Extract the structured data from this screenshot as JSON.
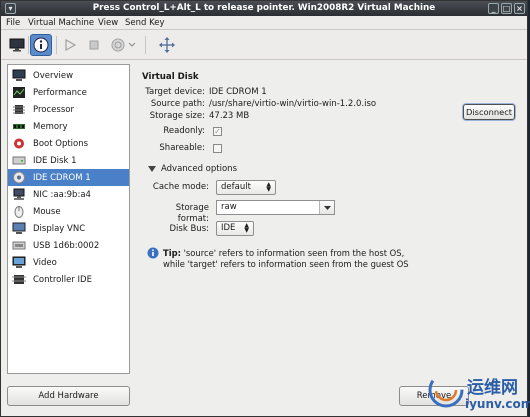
{
  "window": {
    "title": "Press Control_L+Alt_L to release pointer. Win2008R2 Virtual Machine"
  },
  "menubar": {
    "items": [
      "File",
      "Virtual Machine",
      "View",
      "Send Key"
    ]
  },
  "toolbar": {
    "buttons": [
      "screen-icon",
      "info-icon",
      "play-icon",
      "pause-icon",
      "power-icon",
      "dropdown-arrow-icon",
      "fullscreen-icon"
    ],
    "active": "info-icon"
  },
  "sidebar": {
    "items": [
      {
        "label": "Overview",
        "icon": "overview-icon"
      },
      {
        "label": "Performance",
        "icon": "performance-icon"
      },
      {
        "label": "Processor",
        "icon": "processor-icon"
      },
      {
        "label": "Memory",
        "icon": "memory-icon"
      },
      {
        "label": "Boot Options",
        "icon": "boot-icon"
      },
      {
        "label": "IDE Disk 1",
        "icon": "disk-icon"
      },
      {
        "label": "IDE CDROM 1",
        "icon": "cdrom-icon"
      },
      {
        "label": "NIC :aa:9b:a4",
        "icon": "nic-icon"
      },
      {
        "label": "Mouse",
        "icon": "mouse-icon"
      },
      {
        "label": "Display VNC",
        "icon": "display-icon"
      },
      {
        "label": "USB 1d6b:0002",
        "icon": "usb-icon"
      },
      {
        "label": "Video",
        "icon": "video-icon"
      },
      {
        "label": "Controller IDE",
        "icon": "controller-icon"
      }
    ],
    "selected_index": 6,
    "add_hardware_label": "Add Hardware"
  },
  "details": {
    "title": "Virtual Disk",
    "target_device_label": "Target device:",
    "target_device": "IDE CDROM 1",
    "source_path_label": "Source path:",
    "source_path": "/usr/share/virtio-win/virtio-win-1.2.0.iso",
    "storage_size_label": "Storage size:",
    "storage_size": "47.23 MB",
    "disconnect_label": "Disconnect",
    "readonly_label": "Readonly:",
    "readonly_checked": true,
    "shareable_label": "Shareable:",
    "shareable_checked": false,
    "advanced_label": "Advanced options",
    "cache_mode_label": "Cache mode:",
    "cache_mode": "default",
    "storage_format_label": "Storage format:",
    "storage_format": "raw",
    "disk_bus_label": "Disk Bus:",
    "disk_bus": "IDE",
    "tip_bold": "Tip:",
    "tip_text": "'source' refers to information seen from the host OS, while 'target' refers to information seen from the guest OS",
    "remove_label": "Remove"
  },
  "watermark": {
    "cn_text": "运维网",
    "domain": "iyunv.com"
  },
  "colors": {
    "selection": "#4a80c8",
    "titlebar": "#2b2e33",
    "watermark": "#2c5ea8"
  }
}
